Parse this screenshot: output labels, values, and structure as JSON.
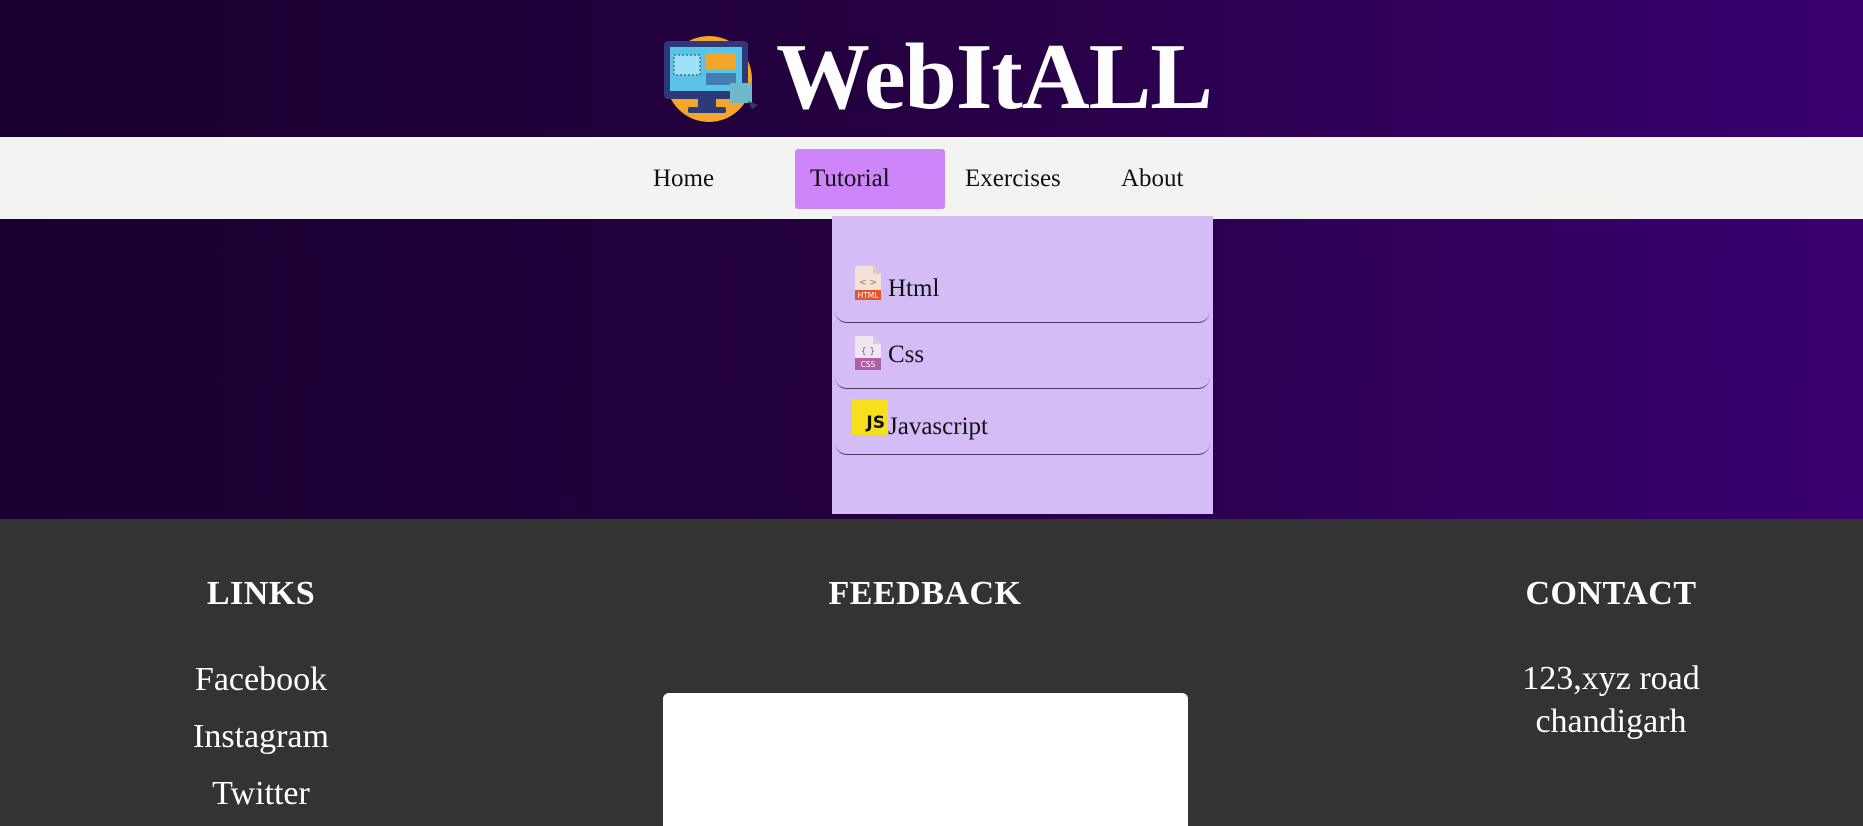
{
  "brand": {
    "title": "WebItALL",
    "logo_icon": "computer-screen-logo-icon"
  },
  "nav": {
    "items": [
      {
        "label": "Home"
      },
      {
        "label": "Tutorial",
        "active": true
      },
      {
        "label": "Exercises"
      },
      {
        "label": "About"
      }
    ]
  },
  "dropdown": {
    "items": [
      {
        "label": "Html",
        "icon": "html-file-icon"
      },
      {
        "label": "Css",
        "icon": "css-file-icon"
      },
      {
        "label": "Javascript",
        "icon": "js-icon",
        "icon_text": "JS"
      }
    ]
  },
  "footer": {
    "links": {
      "heading": "LINKS",
      "items": [
        "Facebook",
        "Instagram",
        "Twitter"
      ]
    },
    "feedback": {
      "heading": "FEEDBACK"
    },
    "contact": {
      "heading": "CONTACT",
      "lines": [
        "123,xyz road",
        "chandigarh"
      ]
    }
  },
  "colors": {
    "hero_gradient_start": "#1a0030",
    "hero_gradient_end": "#3a0070",
    "navbar_bg": "#f2f4f1",
    "nav_active_bg": "#cf85fa",
    "dropdown_bg": "#d4bdf7",
    "footer_bg": "#333333",
    "js_badge": "#f7df1e"
  }
}
